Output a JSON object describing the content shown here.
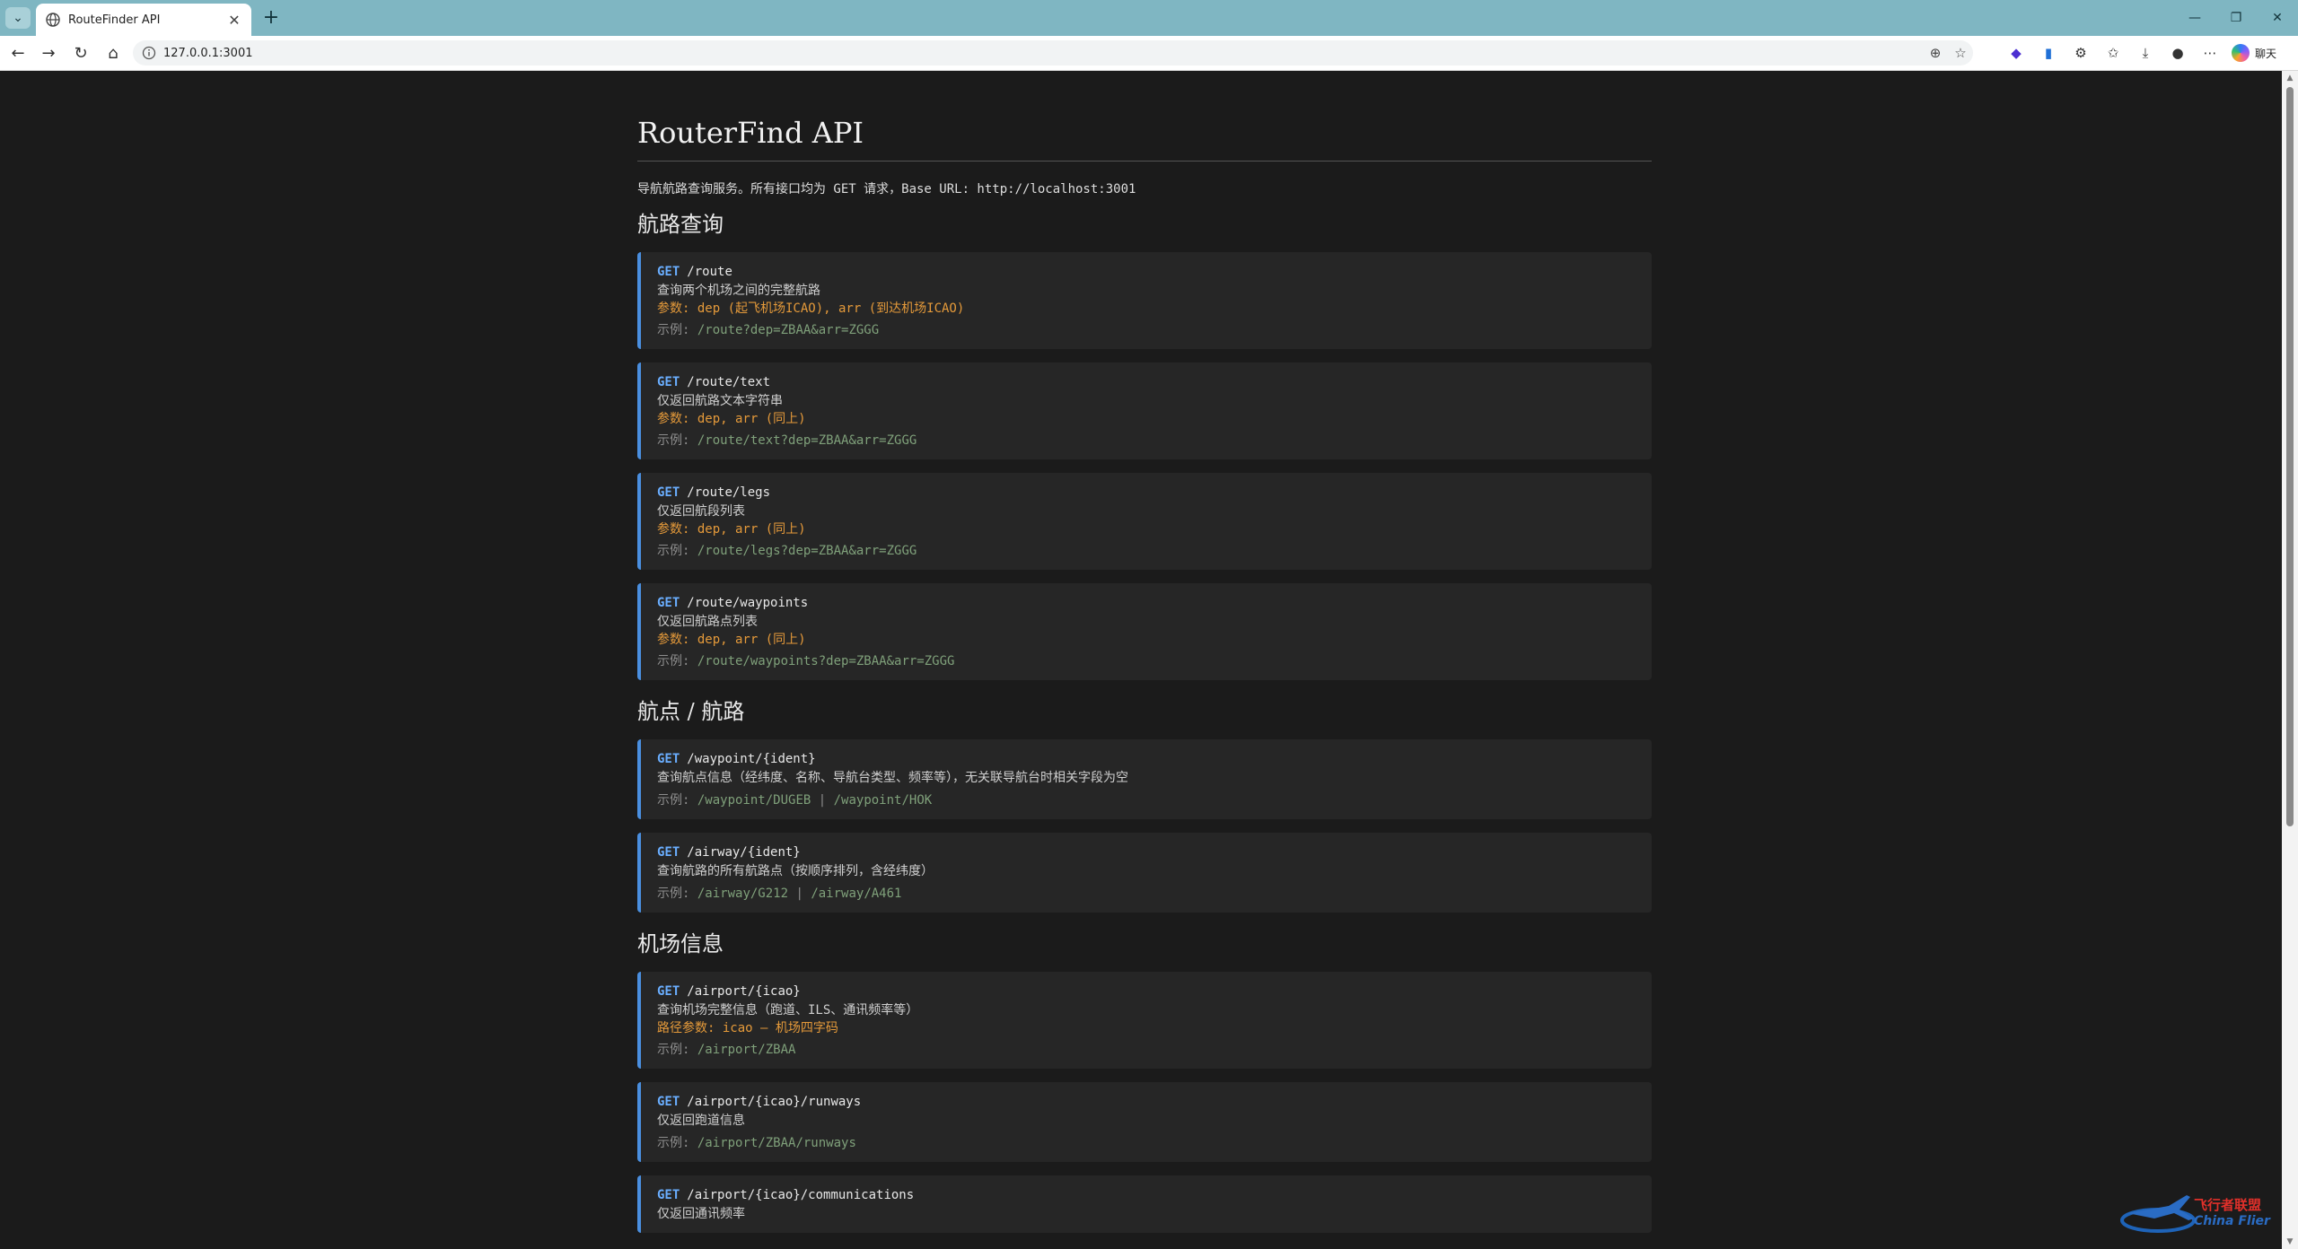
{
  "browser": {
    "tab_title": "RouteFinder API",
    "url": "127.0.0.1:3001",
    "chat_label": "聊天"
  },
  "page": {
    "title": "RouterFind API",
    "intro": "导航航路查询服务。所有接口均为 GET 请求，Base URL: http://localhost:3001",
    "sections": [
      {
        "heading": "航路查询",
        "endpoints": [
          {
            "method": "GET",
            "path": "/route",
            "desc": "查询两个机场之间的完整航路",
            "params": "参数: dep (起飞机场ICAO), arr (到达机场ICAO)",
            "example_label": "示例:",
            "examples": [
              "/route?dep=ZBAA&arr=ZGGG"
            ]
          },
          {
            "method": "GET",
            "path": "/route/text",
            "desc": "仅返回航路文本字符串",
            "params": "参数: dep, arr (同上)",
            "example_label": "示例:",
            "examples": [
              "/route/text?dep=ZBAA&arr=ZGGG"
            ]
          },
          {
            "method": "GET",
            "path": "/route/legs",
            "desc": "仅返回航段列表",
            "params": "参数: dep, arr (同上)",
            "example_label": "示例:",
            "examples": [
              "/route/legs?dep=ZBAA&arr=ZGGG"
            ]
          },
          {
            "method": "GET",
            "path": "/route/waypoints",
            "desc": "仅返回航路点列表",
            "params": "参数: dep, arr (同上)",
            "example_label": "示例:",
            "examples": [
              "/route/waypoints?dep=ZBAA&arr=ZGGG"
            ]
          }
        ]
      },
      {
        "heading": "航点 / 航路",
        "endpoints": [
          {
            "method": "GET",
            "path": "/waypoint/{ident}",
            "desc": "查询航点信息（经纬度、名称、导航台类型、频率等），无关联导航台时相关字段为空",
            "params": "",
            "example_label": "示例:",
            "examples": [
              "/waypoint/DUGEB",
              "/waypoint/HOK"
            ]
          },
          {
            "method": "GET",
            "path": "/airway/{ident}",
            "desc": "查询航路的所有航路点（按顺序排列，含经纬度）",
            "params": "",
            "example_label": "示例:",
            "examples": [
              "/airway/G212",
              "/airway/A461"
            ]
          }
        ]
      },
      {
        "heading": "机场信息",
        "endpoints": [
          {
            "method": "GET",
            "path": "/airport/{icao}",
            "desc": "查询机场完整信息（跑道、ILS、通讯频率等）",
            "params": "路径参数: icao — 机场四字码",
            "example_label": "示例:",
            "examples": [
              "/airport/ZBAA"
            ]
          },
          {
            "method": "GET",
            "path": "/airport/{icao}/runways",
            "desc": "仅返回跑道信息",
            "params": "",
            "example_label": "示例:",
            "examples": [
              "/airport/ZBAA/runways"
            ]
          },
          {
            "method": "GET",
            "path": "/airport/{icao}/communications",
            "desc": "仅返回通讯频率",
            "params": "",
            "example_label": "示例:",
            "examples": []
          }
        ]
      }
    ]
  },
  "watermark": {
    "cn": "飞行者联盟",
    "en": "China Flier"
  },
  "colors": {
    "accent": "#4a8fe0",
    "method": "#6aaeff",
    "params": "#e59a3a",
    "example": "#7fa07a",
    "tabbar": "#7fb6c2"
  }
}
